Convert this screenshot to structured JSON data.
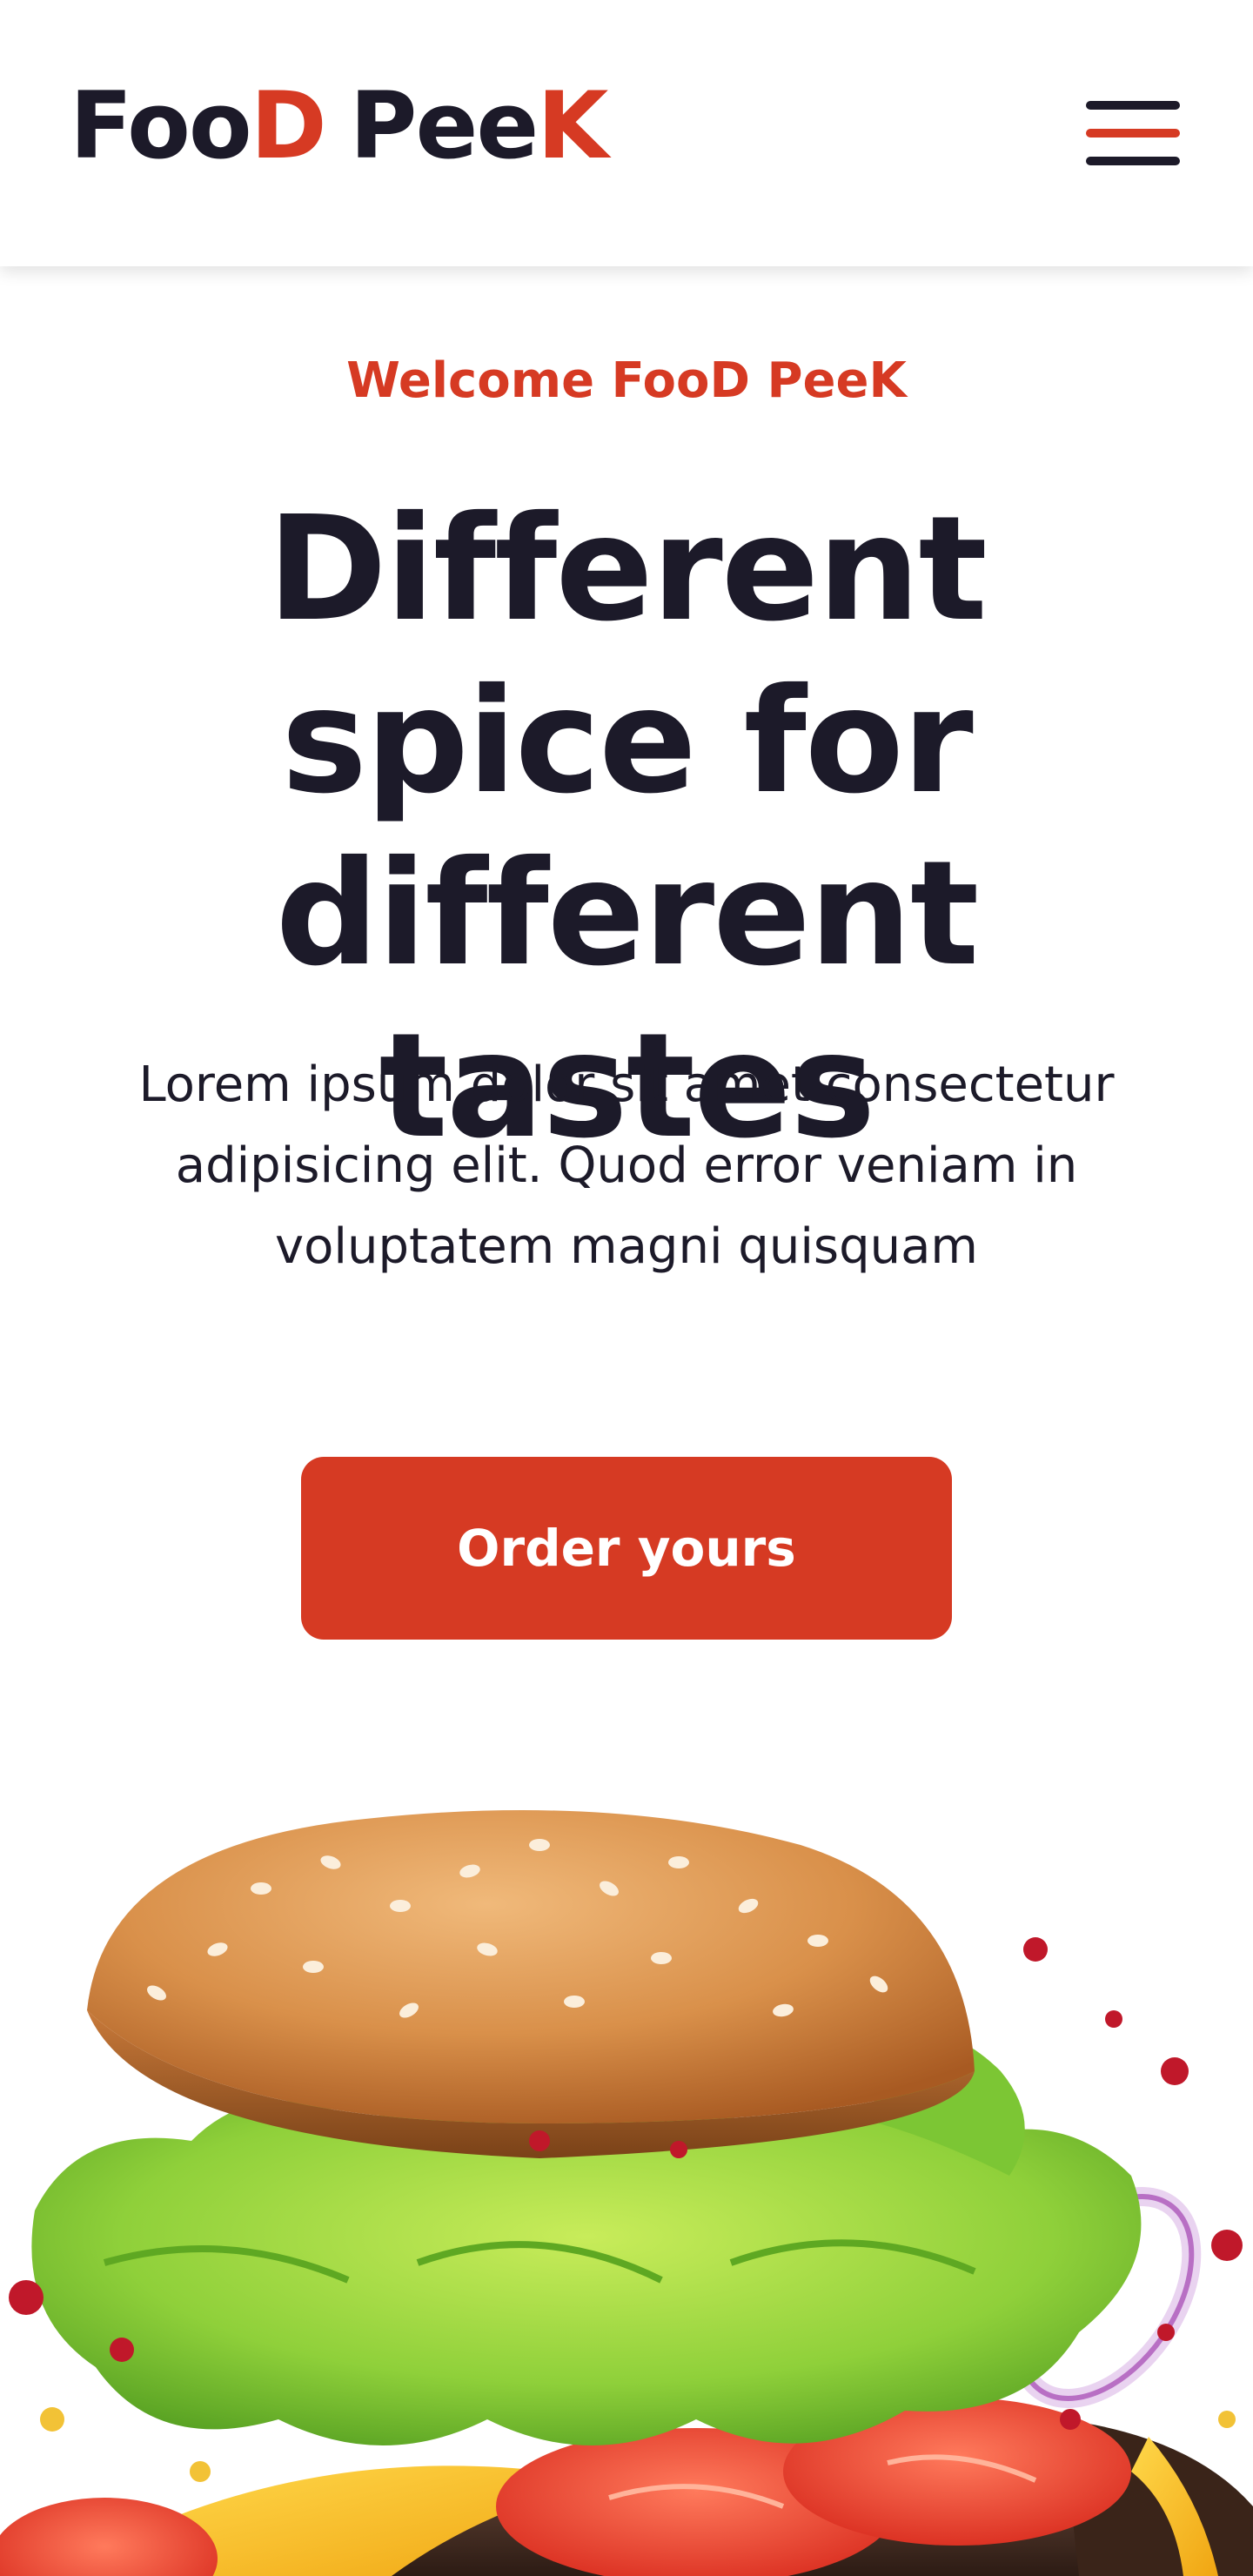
{
  "header": {
    "logo": [
      {
        "text": "Foo",
        "tone": "dark"
      },
      {
        "text": "D",
        "tone": "red"
      },
      {
        "text": "Pee",
        "tone": "dark"
      },
      {
        "text": "K",
        "tone": "red"
      }
    ],
    "menu_icon": "hamburger-menu-icon"
  },
  "hero": {
    "eyebrow": "Welcome FooD PeeK",
    "headline": "Different spice for different tastes",
    "lede": "Lorem ipsum dolor sit amet consectetur adipisicing elit. Quod error veniam in voluptatem magni quisquam",
    "cta_label": "Order yours",
    "image_subject": "burger-image"
  },
  "colors": {
    "accent": "#d63a23",
    "text_dark": "#1c1a29",
    "background": "#ffffff"
  }
}
